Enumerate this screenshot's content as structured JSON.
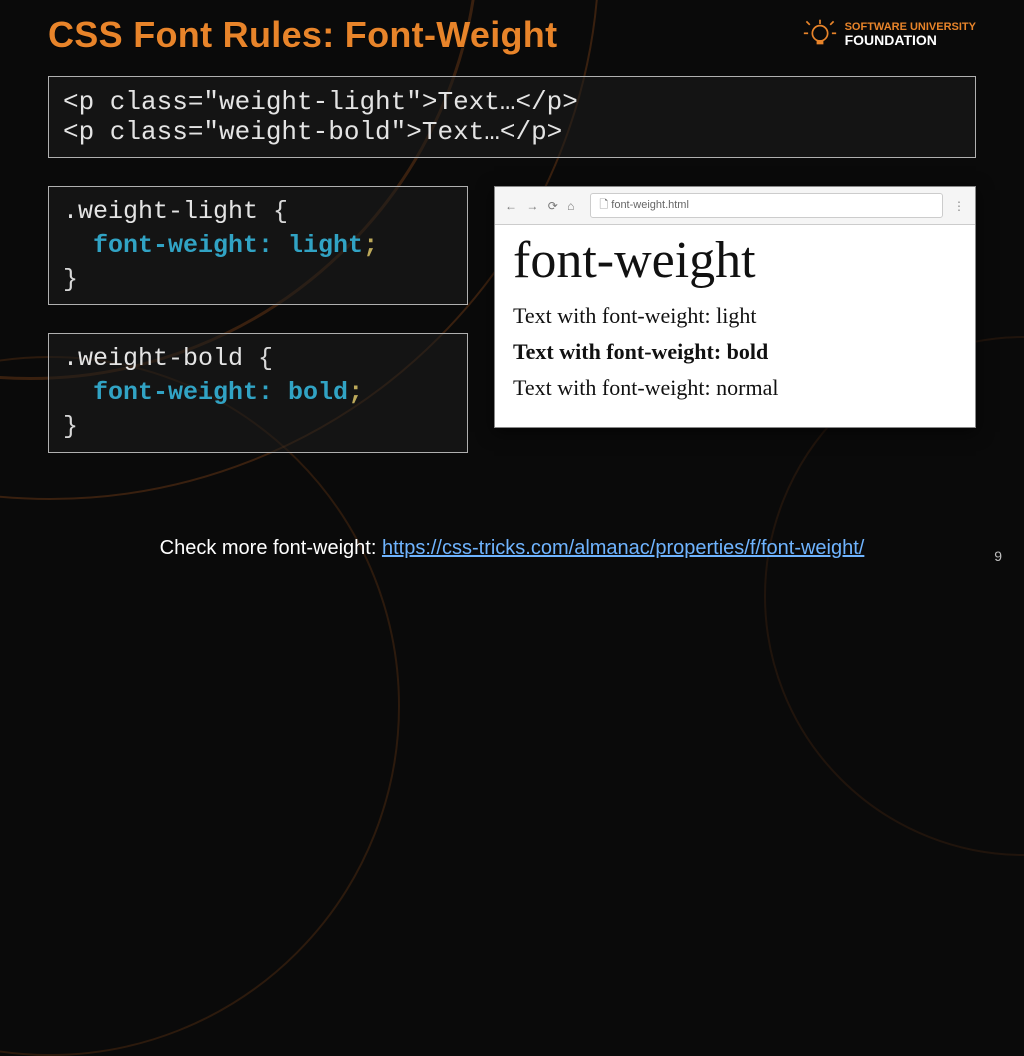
{
  "title": "CSS Font Rules: Font-Weight",
  "logo": {
    "line1": "SOFTWARE UNIVERSITY",
    "line2": "FOUNDATION"
  },
  "code_html": {
    "line1": "<p class=\"weight-light\">Text…</p>",
    "line2": "<p class=\"weight-bold\">Text…</p>"
  },
  "css_light": {
    "selector": ".weight-light",
    "open": " {",
    "prop": "font-weight:",
    "val": " light",
    "semi": ";",
    "close": "}"
  },
  "css_bold": {
    "selector": ".weight-bold",
    "open": " {",
    "prop": "font-weight:",
    "val": " bold",
    "semi": ";",
    "close": "}"
  },
  "browser": {
    "nav_back": "←",
    "nav_fwd": "→",
    "nav_reload": "⟳",
    "nav_home": "⌂",
    "url_icon": "🗋",
    "url": "font-weight.html",
    "menu": "⋮",
    "heading": "font-weight",
    "line_light": "Text with font-weight: light",
    "line_bold": "Text with font-weight: bold",
    "line_normal": "Text with font-weight: normal"
  },
  "footer": {
    "text": "Check more font-weight: ",
    "link": "https://css-tricks.com/almanac/properties/f/font-weight/"
  },
  "page_number": "9"
}
